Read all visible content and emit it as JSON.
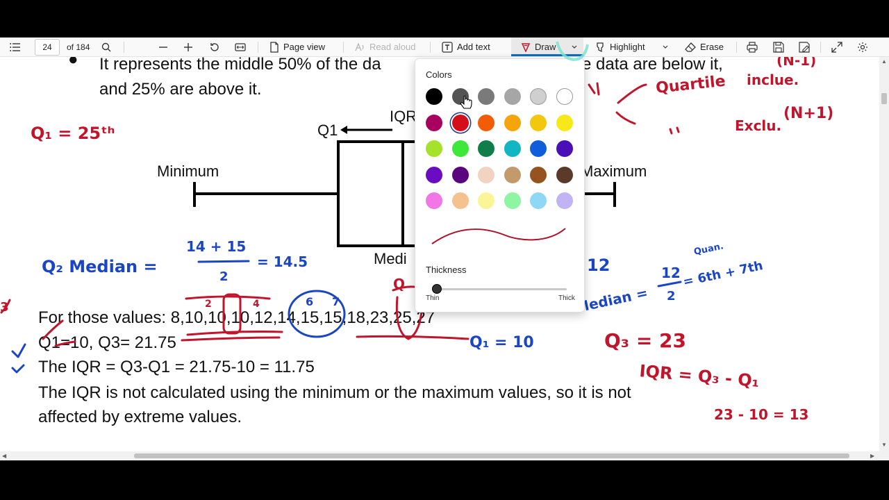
{
  "toolbar": {
    "page_number": "24",
    "page_total": "of 184",
    "page_view": "Page view",
    "read_aloud": "Read aloud",
    "add_text": "Add text",
    "draw": "Draw",
    "highlight": "Highlight",
    "erase": "Erase"
  },
  "document": {
    "bullet_line1": "It represents the middle 50% of the da",
    "bullet_line1_right": "e data are below it,",
    "bullet_line2": "and 25% are above it.",
    "diagram": {
      "q1": "Q1",
      "iqr": "IQR",
      "minimum": "Minimum",
      "maximum": "Maximum",
      "median": "Medi"
    },
    "values_label": "For those values: ",
    "values": "8,10,10,10,12,14,15,15,18,23,25,27",
    "quartiles": "Q1=10, Q3= 21.75",
    "iqr_formula": "The IQR = Q3-Q1 = 21.75-10 = 11.75",
    "note_line1": "The IQR is not calculated  using the minimum or the maximum values, so it is not",
    "note_line2": "affected by extreme values."
  },
  "handwriting": {
    "q1_note": "Q₁ = 25ᵗʰ",
    "q2_median": "Q₂  Median =",
    "fraction_top": "14 + 15",
    "fraction_bottom": "2",
    "fraction_result": "= 14.5",
    "twelve": "12",
    "median_formula": "Median =",
    "median_num": "12",
    "median_den": "2",
    "median_result": "= 6th + 7th",
    "quan": "Quan.",
    "quartile": "Quartile",
    "inclus": "inclue.",
    "exclus": "Exclu.",
    "n_plus_1": "(N+1)",
    "n_minus_1": "(N-1)",
    "q1_eq": "Q₁ = 10",
    "q3_eq": "Q₃ = 23",
    "iqr_eq": "IQR = Q₃ - Q₁",
    "calc": "23 - 10 = 13",
    "idx_2": "2",
    "idx_4": "4",
    "idx_6": "6",
    "idx_7": "7",
    "q_label": "Q",
    "three": "3"
  },
  "draw_panel": {
    "colors_label": "Colors",
    "thickness_label": "Thickness",
    "thin_label": "Thin",
    "thick_label": "Thick",
    "selected_color": "#d40f1a",
    "swatches": [
      [
        "#000000",
        "#545454",
        "#7a7a7a",
        "#a6a6a6",
        "#cfcfcf",
        "#ffffff"
      ],
      [
        "#a8005e",
        "#d40f1a",
        "#f25c05",
        "#f5a50a",
        "#f2c80f",
        "#f7e81a"
      ],
      [
        "#a4e22b",
        "#3ee83a",
        "#117e4a",
        "#12b5c2",
        "#0f5ddb",
        "#4b0fb8"
      ],
      [
        "#6a0dc2",
        "#5b067e",
        "#f2d3c2",
        "#c29a6b",
        "#96521f",
        "#5c3a2a"
      ],
      [
        "#f277e6",
        "#f5c28f",
        "#fbf597",
        "#8ef5a3",
        "#8ed8f5",
        "#c2b3f5"
      ]
    ]
  }
}
